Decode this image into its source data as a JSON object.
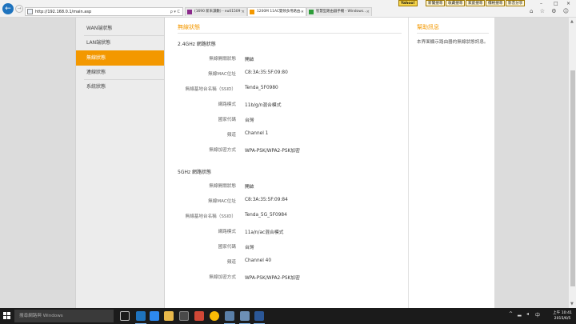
{
  "browser": {
    "url": "http://192.168.0.1/main.asp",
    "address_tools": "ρ ▾ C",
    "tabs": [
      {
        "label": "(1690 新未讀數) - eu01509 -"
      },
      {
        "label": "1200M 11AC雙頻多用路由..."
      },
      {
        "label": "智慧型路由器手機 - Windows..."
      }
    ],
    "window_buttons": [
      "–",
      "□",
      "×"
    ],
    "toolbar": [
      "Yahoo!",
      "新聞搜尋",
      "收藏搜尋",
      "家庭搜尋",
      "價格搜尋",
      "影音分享"
    ],
    "tool_icons": "⌂ ☆ ⚙ ☺"
  },
  "sidebar": {
    "items": [
      {
        "label": "WAN端狀態"
      },
      {
        "label": "LAN端狀態"
      },
      {
        "label": "無線狀態"
      },
      {
        "label": "連線狀態"
      },
      {
        "label": "系統狀態"
      }
    ],
    "active_index": 2
  },
  "main": {
    "title": "無線狀態",
    "groups": [
      {
        "title": "2.4GHz 網路狀態",
        "rows": [
          {
            "label": "無線開關狀態",
            "value": "開啟"
          },
          {
            "label": "無線MAC位址",
            "value": "C8:3A:35:5F:09:80"
          },
          {
            "label": "無線基地台名稱（SSID）",
            "value": "Tenda_5F0980"
          },
          {
            "label": "網路模式",
            "value": "11b/g/n混合模式"
          },
          {
            "label": "國家代碼",
            "value": "台灣"
          },
          {
            "label": "頻道",
            "value": "Channel 1"
          },
          {
            "label": "無線加密方式",
            "value": "WPA-PSK/WPA2-PSK加密"
          }
        ]
      },
      {
        "title": "5GHz 網路狀態",
        "rows": [
          {
            "label": "無線開關狀態",
            "value": "開啟"
          },
          {
            "label": "無線MAC位址",
            "value": "C8:3A:35:5F:09:84"
          },
          {
            "label": "無線基地台名稱（SSID）",
            "value": "Tenda_5G_5F0984"
          },
          {
            "label": "網路模式",
            "value": "11a/n/ac混合模式"
          },
          {
            "label": "國家代碼",
            "value": "台灣"
          },
          {
            "label": "頻道",
            "value": "Channel 40"
          },
          {
            "label": "無線加密方式",
            "value": "WPA-PSK/WPA2-PSK加密"
          }
        ]
      }
    ]
  },
  "help": {
    "title": "幫助訊息",
    "text": "本界面顯示路由器的無線狀態訊息。"
  },
  "taskbar": {
    "search_placeholder": "搜尋網路與 Windows",
    "time": "上午 10:41",
    "date": "2015/6/5"
  },
  "colors": {
    "accent": "#f39800",
    "sidebar_bg": "#ececec",
    "page_bg": "#dcdcdc",
    "taskbar_bg": "#1b1b1b"
  }
}
